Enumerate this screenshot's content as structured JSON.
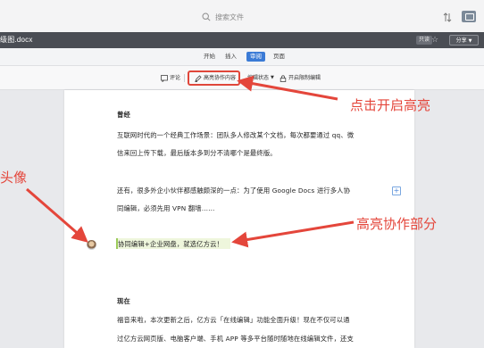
{
  "topbar": {
    "search_placeholder": "搜索文件"
  },
  "docbar": {
    "title": "级图.docx",
    "edit_badge": "只读",
    "share_label": "分享"
  },
  "tabs": [
    {
      "label": "开始"
    },
    {
      "label": "插入"
    },
    {
      "label": "审阅",
      "active": true
    },
    {
      "label": "页面"
    }
  ],
  "toolbar": {
    "comment_label": "评论",
    "highlight_label": "高亮协作内容",
    "edit_state_label": "编辑状态",
    "restrict_label": "开启限制编辑"
  },
  "document": {
    "heading1": "曾经",
    "para1_line1": "互联网时代的一个经典工作场景：团队多人修改某个文档，每次都要通过 qq、微",
    "para1_line2": "信来回上传下载，最后版本多到分不清哪个是最终版。",
    "para2_line1": "还有，很多外企小伙伴都感触颇深的一点：为了使用 Google Docs 进行多人协",
    "para2_line2": "同编辑，必须先用 VPN 翻墙……",
    "highlight_line": "协同编辑+企业网盘，就选亿方云！",
    "heading2": "现在",
    "para3_line1": "福音来啦，本次更新之后，亿方云「在线编辑」功能全面升级！现在不仅可以通",
    "para3_line2": "过亿方云网页版、电脑客户端、手机 APP 等多平台随时随地在线编辑文件，还支"
  },
  "annotations": {
    "click_highlight": "点击开启高亮",
    "avatar_label": "头像",
    "highlight_part": "高亮协作部分"
  },
  "colors": {
    "accent": "#3b7bd6",
    "annotation_red": "#e4463b",
    "highlight_green": "#eef6dc"
  }
}
